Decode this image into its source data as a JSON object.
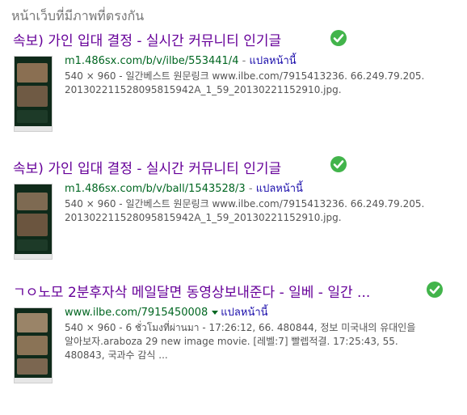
{
  "section_heading": "หน้าเว็บที่มีภาพที่ตรงกัน",
  "colors": {
    "title": "#660099",
    "url": "#006621",
    "translate": "#1a0dab",
    "snippet": "#545454",
    "check": "#42b44b"
  },
  "results": [
    {
      "title": "속보) 가인 입대 결정 - 실시간 커뮤니티 인기글",
      "url": "m1.486sx.com/b/v/ilbe/553441/4",
      "separator": "-",
      "translate_label": "แปลหน้านี้",
      "snippet_line1": "540 × 960 - 일간베스트 원문링크 www.ilbe.com/7915413236. 66.249.79.205.",
      "snippet_line2": "20130221152809581594​2A_1_59_20130221152910.jpg.",
      "icon": "check-circle-icon"
    },
    {
      "title": "속보) 가인 입대 결정 - 실시간 커뮤니티 인기글",
      "url": "m1.486sx.com/b/v/ball/1543528/3",
      "separator": "-",
      "translate_label": "แปลหน้านี้",
      "snippet_line1": "540 × 960 - 일간베스트 원문링크 www.ilbe.com/7915413236. 66.249.79.205.",
      "snippet_line2": "20130221152809581594​2A_1_59_20130221152910.jpg.",
      "icon": "check-circle-icon"
    },
    {
      "title": "ㄱㅇ노모 2분후자삭 메일달면 동영상보내준다 - 일베 - 일간 ...",
      "url": "www.ilbe.com/7915450008",
      "separator": "",
      "translate_label": "แปลหน้านี้",
      "snippet_line1": "540 × 960 - 6 ชั่วโมงที่ผ่านมา - 17:26:12, 66. 480844, 정보 미국내의 유대인을",
      "snippet_line2": "알아보자.araboza 29 new image movie. [레벨:7] 빨렙적결. 17:25:43, 55.",
      "snippet_line3": "480843, 국과수 감식 ...",
      "icon": "check-circle-icon"
    }
  ]
}
